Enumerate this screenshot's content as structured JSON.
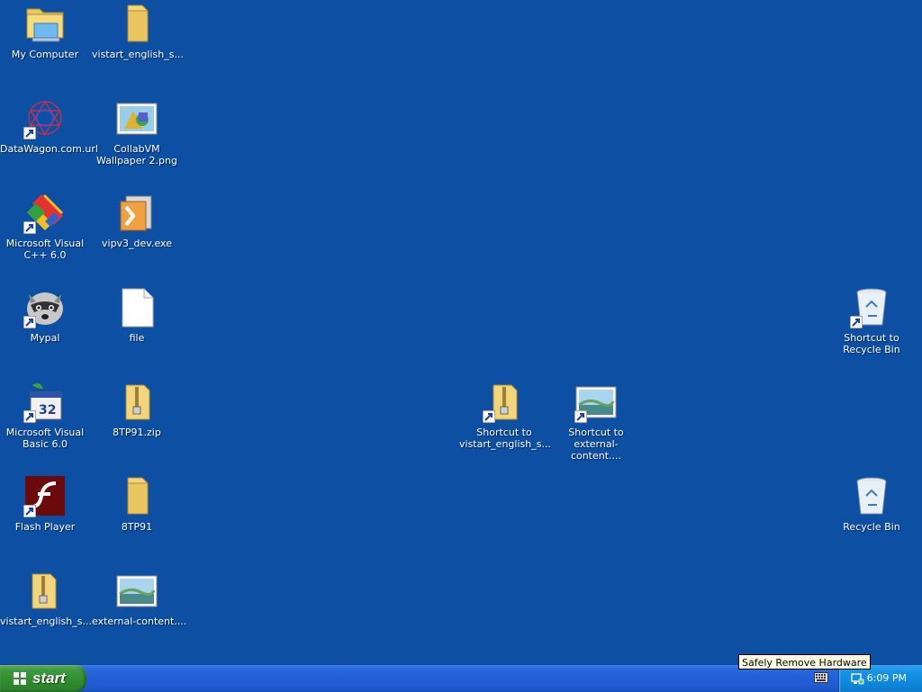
{
  "desktop": {
    "icons": [
      {
        "label": "My Computer",
        "icon": "my-computer-icon"
      },
      {
        "label": "vistart_english_s...",
        "icon": "folder-icon"
      },
      {
        "label": "DataWagon.com.url",
        "icon": "url-shortcut-icon"
      },
      {
        "label": "CollabVM Wallpaper 2.png",
        "icon": "image-file-icon"
      },
      {
        "label": "Microsoft Visual C++ 6.0",
        "icon": "visual-cpp-icon"
      },
      {
        "label": "vipv3_dev.exe",
        "icon": "installer-icon"
      },
      {
        "label": "Mypal",
        "icon": "mypal-icon"
      },
      {
        "label": "file",
        "icon": "blank-file-icon"
      },
      {
        "label": "Microsoft Visual Basic 6.0",
        "icon": "visual-basic-icon"
      },
      {
        "label": "8TP91.zip",
        "icon": "zip-folder-icon"
      },
      {
        "label": "Flash Player",
        "icon": "flash-player-icon"
      },
      {
        "label": "8TP91",
        "icon": "folder-icon"
      },
      {
        "label": "vistart_english_s...",
        "icon": "zip-folder-icon"
      },
      {
        "label": "external-content....",
        "icon": "image-file-icon"
      },
      {
        "label": "Shortcut to vistart_english_s...",
        "icon": "zip-folder-icon"
      },
      {
        "label": "Shortcut to external-content....",
        "icon": "image-file-icon"
      },
      {
        "label": "Shortcut to Recycle Bin",
        "icon": "recycle-bin-icon"
      },
      {
        "label": "Recycle Bin",
        "icon": "recycle-bin-icon"
      }
    ]
  },
  "taskbar": {
    "start_label": "start",
    "clock": "6:09 PM",
    "tooltip": "Safely Remove Hardware"
  },
  "colors": {
    "desktop_bg": "#0d4fa2",
    "taskbar_blue": "#2260d8",
    "start_green": "#3e9a3e",
    "tray_blue": "#0f86da"
  }
}
